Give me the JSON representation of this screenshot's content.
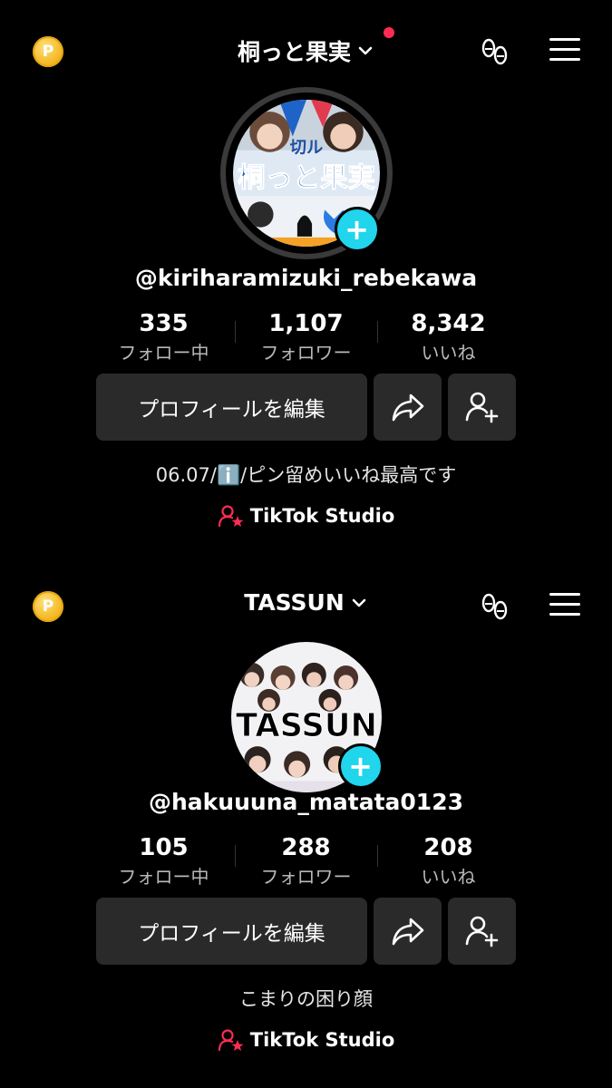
{
  "profiles": [
    {
      "coin_label": "P",
      "title": "桐っと果実",
      "handle": "@kiriharamizuki_rebekawa",
      "stats": [
        {
          "value": "335",
          "label": "フォロー中"
        },
        {
          "value": "1,107",
          "label": "フォロワー"
        },
        {
          "value": "8,342",
          "label": "いいね"
        }
      ],
      "edit_label": "プロフィールを編集",
      "bio": "06.07/ℹ️/ピン留めいいね最高です",
      "studio_label": "TikTok Studio",
      "avatar_text": {
        "line1": "切ル",
        "line2": "桐っと果実"
      }
    },
    {
      "coin_label": "P",
      "title": "TASSUN",
      "handle": "@hakuuuna_matata0123",
      "stats": [
        {
          "value": "105",
          "label": "フォロー中"
        },
        {
          "value": "288",
          "label": "フォロワー"
        },
        {
          "value": "208",
          "label": "いいね"
        }
      ],
      "edit_label": "プロフィールを編集",
      "bio": "こまりの困り顔",
      "studio_label": "TikTok Studio",
      "avatar_text": {
        "line1": "TASSUN"
      }
    }
  ],
  "colors": {
    "background": "#000000",
    "button": "#2a2a2a",
    "accent_plus": "#20d5ec",
    "notification": "#fe2c55",
    "coin": "#f3b319"
  }
}
